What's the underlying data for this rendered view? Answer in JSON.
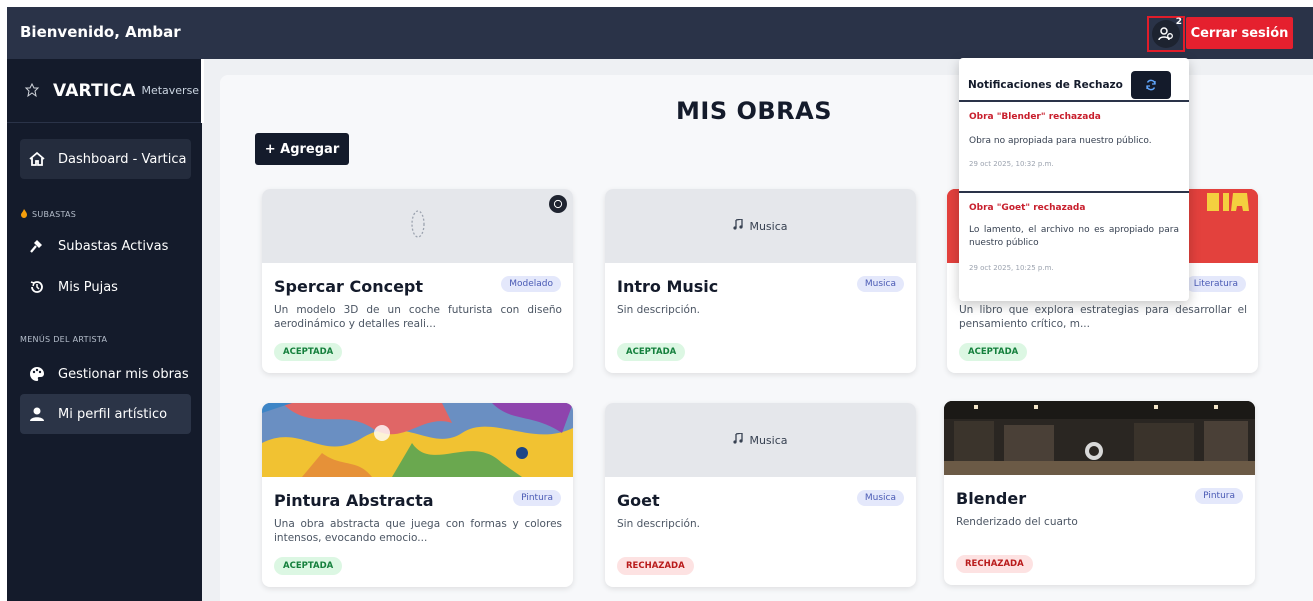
{
  "header": {
    "welcome": "Bienvenido, Ambar",
    "notification_count": "2",
    "logout_label": "Cerrar sesión"
  },
  "sidebar": {
    "brand_name": "VARTICA",
    "brand_sub": "Metaverse",
    "dashboard_label": "Dashboard - Vartica",
    "section_subastas": "SUBASTAS",
    "subastas_activas": "Subastas Activas",
    "mis_pujas": "Mis Pujas",
    "section_artista": "MENÚS DEL ARTISTA",
    "gestionar_obras": "Gestionar mis obras",
    "perfil_artistico": "Mi perfil artístico"
  },
  "main": {
    "title": "MIS OBRAS",
    "add_label": "+ Agregar"
  },
  "cards": [
    {
      "title": "Spercar Concept",
      "category": "Modelado",
      "description": "Un modelo 3D de un coche futurista con diseño aerodinámico y detalles reali...",
      "status": "ACEPTADA",
      "media": "model-3d"
    },
    {
      "title": "Intro Music",
      "category": "Musica",
      "description": "Sin descripción.",
      "status": "ACEPTADA",
      "media": "music",
      "media_label": "Musica"
    },
    {
      "title": "",
      "category": "Literatura",
      "description": "Un libro que explora estrategias para desarrollar el pensamiento crítico, m...",
      "status": "ACEPTADA",
      "media": "cover-image"
    },
    {
      "title": "Pintura Abstracta",
      "category": "Pintura",
      "description": "Una obra abstracta que juega con formas y colores intensos, evocando emocio...",
      "status": "ACEPTADA",
      "media": "painting-image"
    },
    {
      "title": "Goet",
      "category": "Musica",
      "description": "Sin descripción.",
      "status": "RECHAZADA",
      "media": "music",
      "media_label": "Musica"
    },
    {
      "title": "Blender",
      "category": "Pintura",
      "description": "Renderizado del cuarto",
      "status": "RECHAZADA",
      "media": "room-render-image"
    }
  ],
  "notifications": {
    "title": "Notificaciones de Rechazo",
    "items": [
      {
        "title": "Obra \"Blender\" rechazada",
        "message": "Obra no apropiada para nuestro público.",
        "time": "29 oct 2025, 10:32 p.m."
      },
      {
        "title": "Obra \"Goet\" rechazada",
        "message": "Lo lamento, el archivo no es apropiado para nuestro público",
        "time": "29 oct 2025, 10:25 p.m."
      }
    ]
  },
  "colors": {
    "topbar": "#2a3348",
    "sidebar": "#141b2b",
    "accent_red": "#e5202e",
    "accepted_bg": "#dcf7e3",
    "rejected_bg": "#fde2e2"
  },
  "icons": {
    "notification": "users-gear-icon",
    "home": "home-icon",
    "gavel": "gavel-icon",
    "history": "history-icon",
    "palette": "palette-icon",
    "user": "user-icon",
    "fire": "fire-icon",
    "refresh": "refresh-icon",
    "music": "music-note-icon"
  }
}
